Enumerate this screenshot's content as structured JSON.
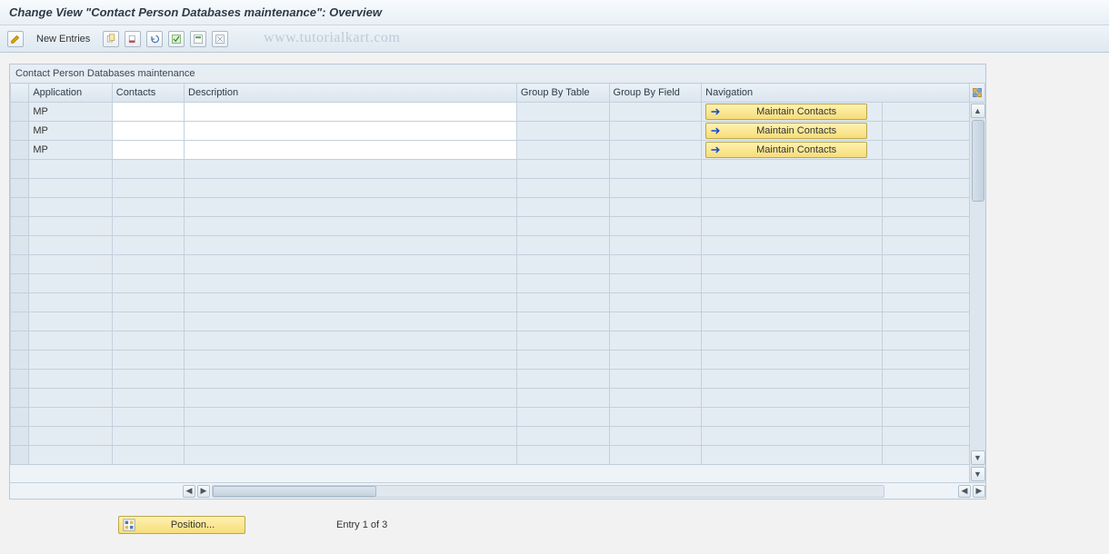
{
  "title": "Change View \"Contact Person Databases maintenance\": Overview",
  "toolbar": {
    "new_entries": "New Entries"
  },
  "watermark": "www.tutorialkart.com",
  "panel": {
    "title": "Contact Person Databases maintenance",
    "columns": {
      "sel": "",
      "application": "Application",
      "contacts": "Contacts",
      "description": "Description",
      "group_by_table": "Group By Table",
      "group_by_field": "Group By Field",
      "navigation": "Navigation"
    },
    "nav_button_label": "Maintain Contacts",
    "rows": [
      {
        "application": "MP",
        "contacts": "",
        "description": "",
        "group_by_table": "",
        "group_by_field": ""
      },
      {
        "application": "MP",
        "contacts": "",
        "description": "",
        "group_by_table": "",
        "group_by_field": ""
      },
      {
        "application": "MP",
        "contacts": "",
        "description": "",
        "group_by_table": "",
        "group_by_field": ""
      }
    ]
  },
  "footer": {
    "position_label": "Position...",
    "entry_text": "Entry 1 of 3"
  }
}
